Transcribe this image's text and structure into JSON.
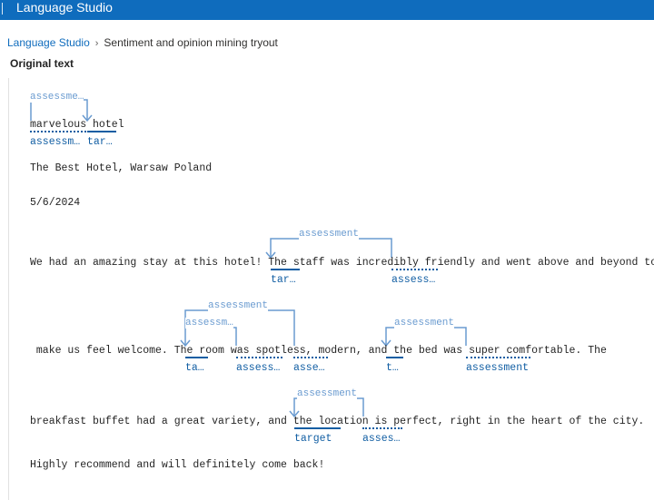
{
  "app": {
    "title": "Language Studio"
  },
  "breadcrumb": {
    "root": "Language Studio",
    "current": "Sentiment and opinion mining tryout"
  },
  "section": {
    "title": "Original text"
  },
  "text_lines": {
    "l0": "marvelous hotel",
    "l1": "The Best Hotel, Warsaw Poland",
    "l2": "5/6/2024",
    "l3": "We had an amazing stay at this hotel! The staff was incredibly friendly and went above and beyond to",
    "l4": " make us feel welcome. The room was spotless, modern, and the bed was super comfortable. The",
    "l5": "breakfast buffet had a great variety, and the location is perfect, right in the heart of the city.",
    "l6": "Highly recommend and will definitely come back!"
  },
  "tags": {
    "marvelous": "assessm…",
    "hotel": "tar…",
    "staff": "tar…",
    "friendly": "assess…",
    "room": "ta…",
    "spotless": "assess…",
    "modern": "asse…",
    "bed": "t…",
    "comfortable": "assessment",
    "location": "target",
    "perfect": "asses…"
  },
  "relations": {
    "r0": "assessme…",
    "r1": "assessment",
    "r2": "assessment",
    "r3": "assessm…",
    "r4": "assessment",
    "r5": "assessment"
  },
  "colors": {
    "brand": "#0f6cbd",
    "tag": "#115ea3",
    "relation": "#6a9bd0"
  }
}
